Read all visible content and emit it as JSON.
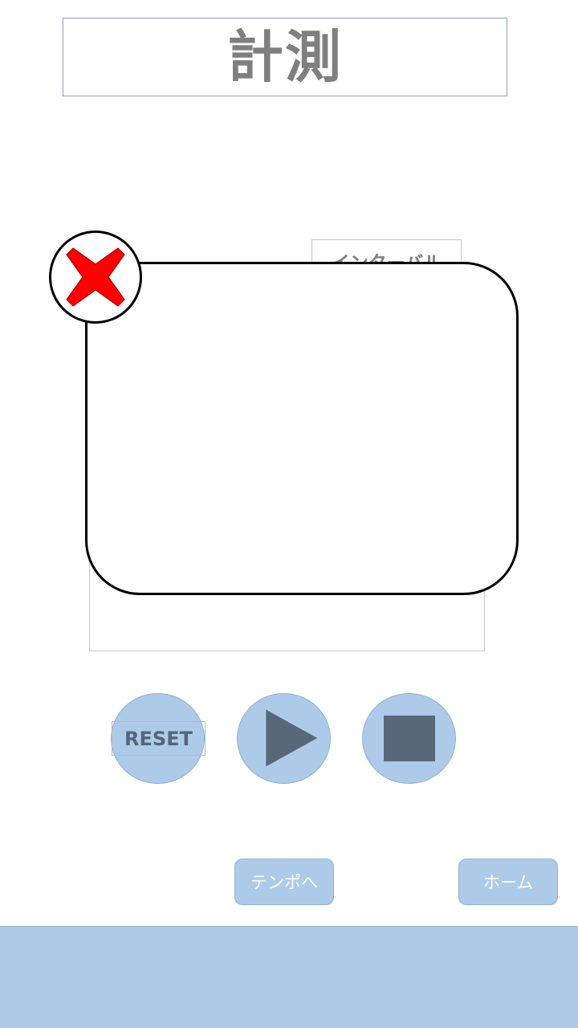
{
  "header": {
    "title": "計測"
  },
  "interval": {
    "label": "インターバル"
  },
  "dialog": {
    "close_icon": "close-x-icon",
    "close_color": "#ff0000"
  },
  "controls": {
    "reset_label": "RESET",
    "play_icon": "play-icon",
    "stop_icon": "stop-icon",
    "button_color": "#adcbe9",
    "icon_color": "#596878"
  },
  "nav": {
    "tempo_label": "テンポへ",
    "home_label": "ホーム"
  },
  "footer": {
    "color": "#adcbe9"
  }
}
